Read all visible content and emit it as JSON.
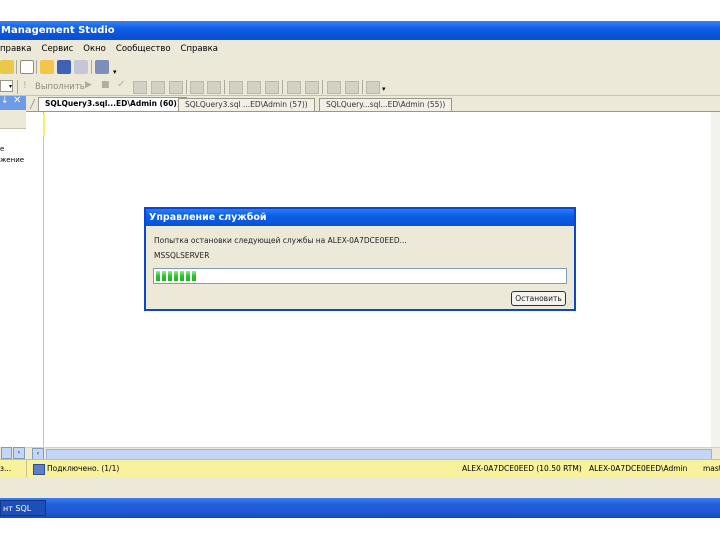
{
  "window": {
    "title": "Management Studio"
  },
  "menubar": {
    "items": [
      "правка",
      "Сервис",
      "Окно",
      "Сообщество",
      "Справка"
    ]
  },
  "toolbar": {
    "execute_label": "Выполнить"
  },
  "tabs": [
    {
      "label": "SQLQuery3.sql...ED\\Admin (60))",
      "active": true
    },
    {
      "label": "SQLQuery3.sql ...ED\\Admin (57))",
      "active": false
    },
    {
      "label": "SQLQuery...sql...ED\\Admin (55))",
      "active": false
    }
  ],
  "left_pane": {
    "text1": "е",
    "text2": "жение"
  },
  "status": {
    "left": "з...",
    "connection": "Подключено. (1/1)",
    "server": "ALEX-0A7DCE0EED (10.50 RTM)",
    "user": "ALEX-0A7DCE0EED\\Admin",
    "tail": "mast"
  },
  "taskbar": {
    "item": "нт SQL"
  },
  "dialog": {
    "title": "Управление службой",
    "message_line1": "Попытка остановки следующей службы на ALEX-0A7DCE0EED...",
    "message_line2": "MSSQLSERVER",
    "progress_fraction": 0.1,
    "stop_button": "Остановить"
  },
  "colors": {
    "accent": "#0a52d6",
    "status_bg": "#f8f29c",
    "progress": "#2bc42b"
  }
}
